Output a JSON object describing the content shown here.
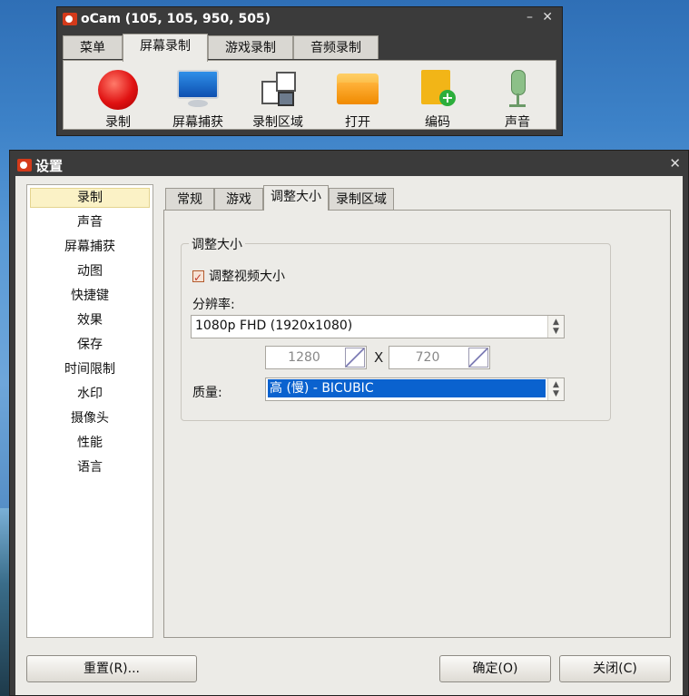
{
  "ocam": {
    "title": "oCam (105, 105, 950, 505)",
    "minimize": "–",
    "close": "✕",
    "tabs": [
      {
        "label": "菜单"
      },
      {
        "label": "屏幕录制"
      },
      {
        "label": "游戏录制"
      },
      {
        "label": "音频录制"
      }
    ],
    "tools": [
      {
        "label": "录制",
        "icon": "record-icon"
      },
      {
        "label": "屏幕捕获",
        "icon": "monitor-icon"
      },
      {
        "label": "录制区域",
        "icon": "capture-area-icon"
      },
      {
        "label": "打开",
        "icon": "folder-icon"
      },
      {
        "label": "编码",
        "icon": "film-add-icon"
      },
      {
        "label": "声音",
        "icon": "microphone-icon"
      }
    ]
  },
  "settings": {
    "title": "设置",
    "close": "✕",
    "sidebar": {
      "items": [
        {
          "label": "录制"
        },
        {
          "label": "声音"
        },
        {
          "label": "屏幕捕获"
        },
        {
          "label": "动图"
        },
        {
          "label": "快捷键"
        },
        {
          "label": "效果"
        },
        {
          "label": "保存"
        },
        {
          "label": "时间限制"
        },
        {
          "label": "水印"
        },
        {
          "label": "摄像头"
        },
        {
          "label": "性能"
        },
        {
          "label": "语言"
        }
      ],
      "selected": "录制"
    },
    "tabs": [
      {
        "label": "常规"
      },
      {
        "label": "游戏"
      },
      {
        "label": "调整大小"
      },
      {
        "label": "录制区域"
      }
    ],
    "active_tab": "调整大小",
    "resize": {
      "group_title": "调整大小",
      "checkbox_label": "调整视频大小",
      "checkbox_checked": true,
      "resolution_label": "分辨率:",
      "resolution_value": "1080p FHD (1920x1080)",
      "width": "1280",
      "times": "X",
      "height": "720",
      "quality_label": "质量:",
      "quality_value": "高 (慢) - BICUBIC"
    },
    "buttons": {
      "reset": "重置(R)...",
      "ok": "确定(O)",
      "close": "关闭(C)"
    }
  }
}
